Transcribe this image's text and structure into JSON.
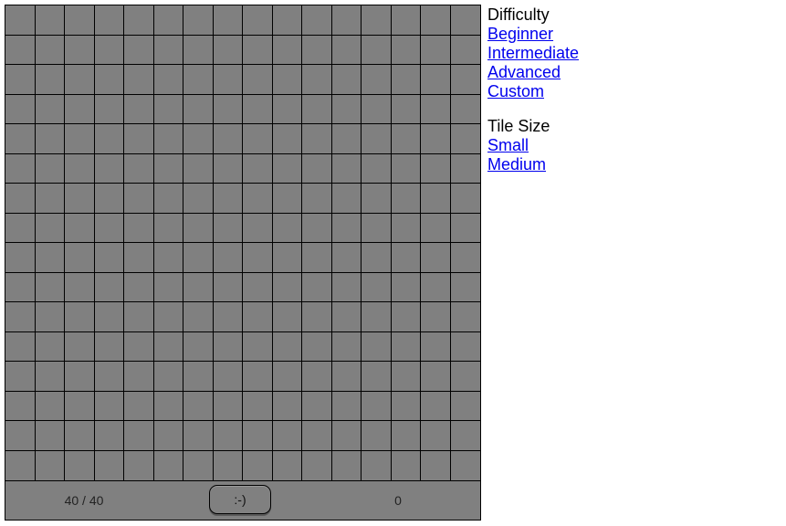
{
  "board": {
    "rows": 16,
    "cols": 16,
    "tile_color": "#808080",
    "state": "all-covered"
  },
  "status": {
    "mines_label": "40 / 40",
    "face_label": ":-)",
    "timer": "0"
  },
  "menu": {
    "difficulty_heading": "Difficulty",
    "difficulty_items": [
      "Beginner",
      "Intermediate",
      "Advanced",
      "Custom"
    ],
    "tile_size_heading": "Tile Size",
    "tile_size_items": [
      "Small",
      "Medium"
    ],
    "link_color": "#0000ee"
  }
}
